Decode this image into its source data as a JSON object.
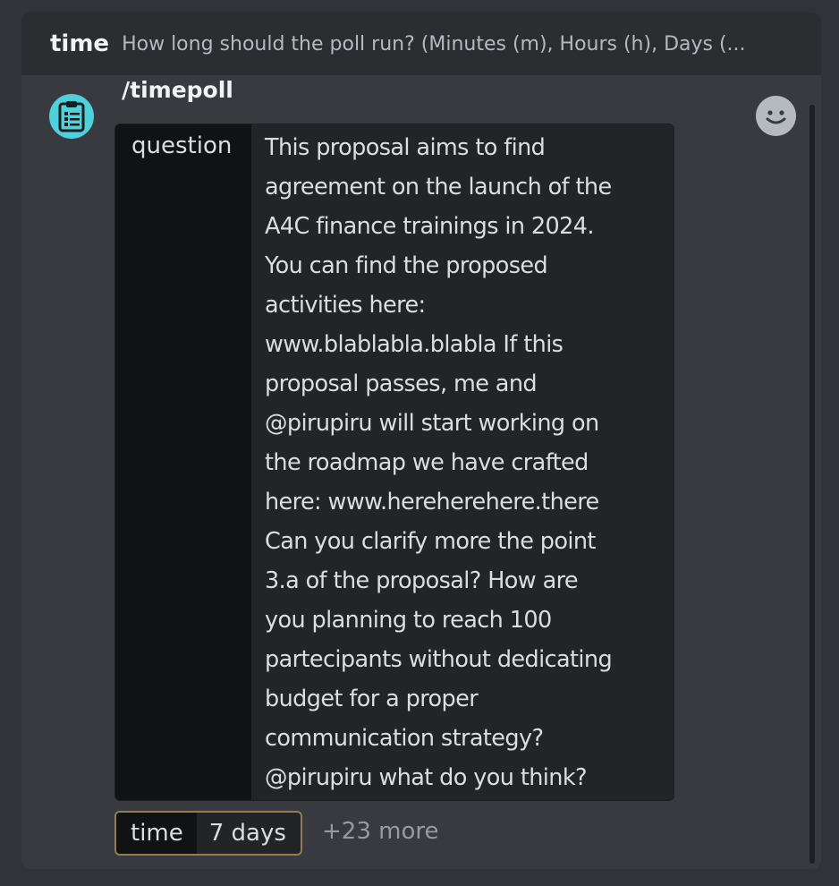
{
  "option_header": {
    "name": "time",
    "description": "How long should the poll run? (Minutes (m), Hours (h), Days (..."
  },
  "command": {
    "title": "/timepoll",
    "icon": "clipboard-list-icon"
  },
  "question_arg": {
    "label": "question",
    "lines": [
      "This proposal aims to find",
      "agreement on the launch of the",
      "A4C finance trainings in 2024.",
      "You can find the proposed",
      "activities here:",
      "www.blablabla.blabla  If this",
      "proposal passes, me and",
      "@pirupiru will start working on",
      "the roadmap we have crafted",
      "here: www.hereherehere.there",
      "Can you clarify more the point",
      "3.a of the proposal? How are",
      "you planning to reach 100",
      "partecipants without dedicating",
      "budget for a proper",
      "communication strategy?",
      "@pirupiru what do you think?"
    ]
  },
  "time_arg": {
    "label": "time",
    "value": "7 days"
  },
  "more_options": "+23 more",
  "icons": {
    "emoji": "emoji-smile-icon"
  },
  "colors": {
    "background": "#313338",
    "panel": "#383a40",
    "header_bar": "#2b2d31",
    "app_icon": "#4fd1db",
    "active_pill_border": "#8e7f59"
  }
}
